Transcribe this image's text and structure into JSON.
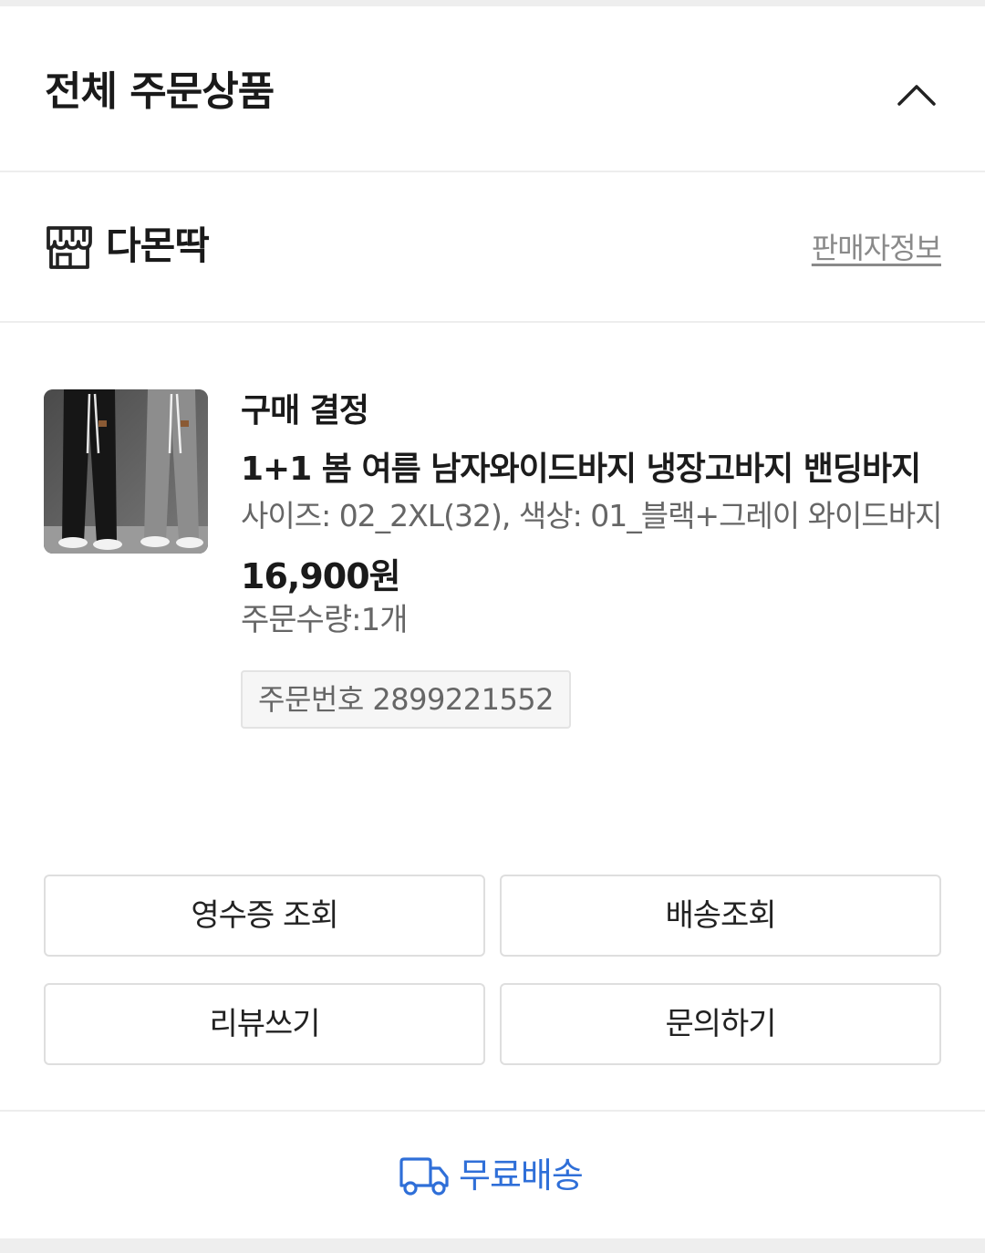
{
  "section": {
    "title": "전체 주문상품"
  },
  "seller": {
    "name": "다몬딱",
    "info_link": "판매자정보"
  },
  "product": {
    "status": "구매 결정",
    "name": "1+1 봄 여름 남자와이드바지 냉장고바지 밴딩바지",
    "option": "사이즈: 02_2XL(32), 색상: 01_블랙+그레이 와이드바지",
    "price": "16,900원",
    "quantity": "주문수량:1개",
    "order_number": "주문번호 2899221552"
  },
  "actions": {
    "receipt": "영수증 조회",
    "tracking": "배송조회",
    "review": "리뷰쓰기",
    "inquiry": "문의하기"
  },
  "shipping": {
    "label": "무료배송",
    "accent_color": "#2f6fd8"
  },
  "icons": {
    "collapse": "chevron-up-icon",
    "store": "store-icon",
    "shipping": "truck-icon"
  }
}
